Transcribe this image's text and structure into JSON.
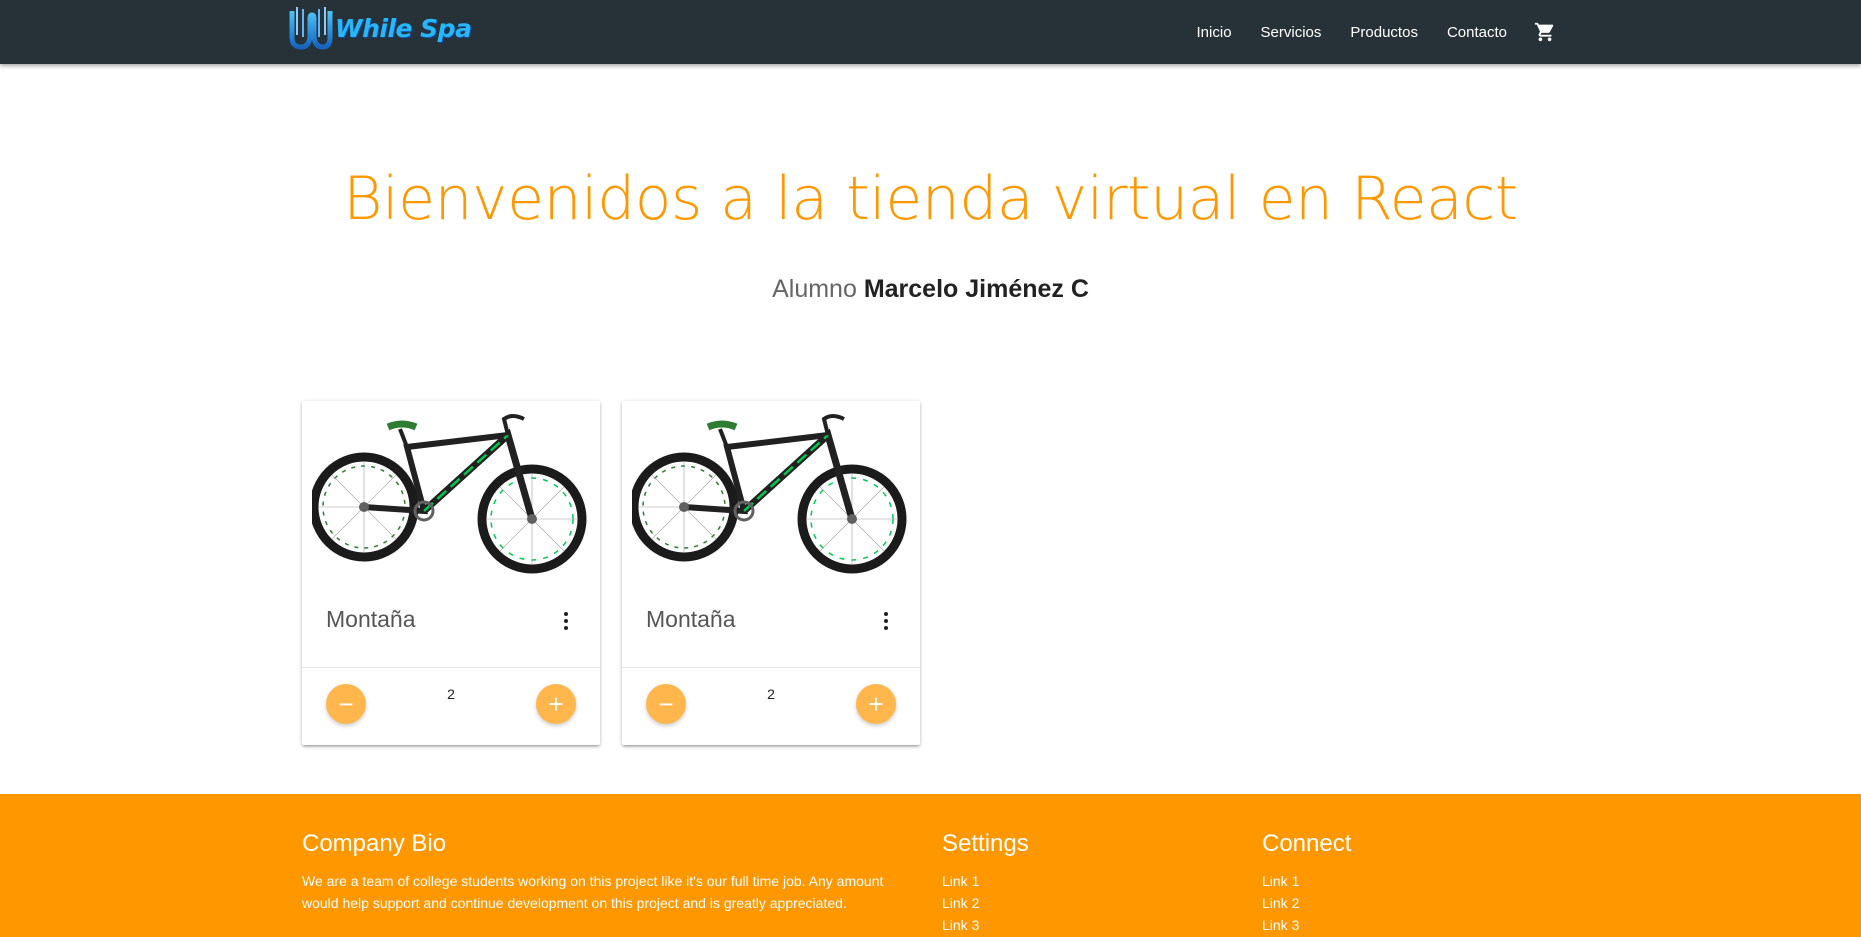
{
  "navbar": {
    "logo_text": "While Spa",
    "links": [
      "Inicio",
      "Servicios",
      "Productos",
      "Contacto"
    ],
    "cart_icon": "shopping-cart-icon",
    "background": "#263238"
  },
  "hero": {
    "title": "Bienvenidos a la tienda virtual en React",
    "subtitle_prefix": "Alumno",
    "student_name": "Marcelo Jiménez C",
    "title_color": "#ff9800"
  },
  "products": [
    {
      "title": "Montaña",
      "quantity": "2",
      "image": "mountain-bike-image",
      "menu_icon": "more-vert-icon",
      "minus_icon": "minus-icon",
      "plus_icon": "plus-icon"
    },
    {
      "title": "Montaña",
      "quantity": "2",
      "image": "mountain-bike-image",
      "menu_icon": "more-vert-icon",
      "minus_icon": "minus-icon",
      "plus_icon": "plus-icon"
    }
  ],
  "footer": {
    "background": "#ff9800",
    "bio": {
      "title": "Company Bio",
      "text": "We are a team of college students working on this project like it's our full time job. Any amount would help support and continue development on this project and is greatly appreciated."
    },
    "settings": {
      "title": "Settings",
      "links": [
        "Link 1",
        "Link 2",
        "Link 3"
      ]
    },
    "connect": {
      "title": "Connect",
      "links": [
        "Link 1",
        "Link 2",
        "Link 3"
      ]
    }
  },
  "colors": {
    "fab": "#ffb74d",
    "accent": "#ff9800",
    "nav": "#263238"
  }
}
